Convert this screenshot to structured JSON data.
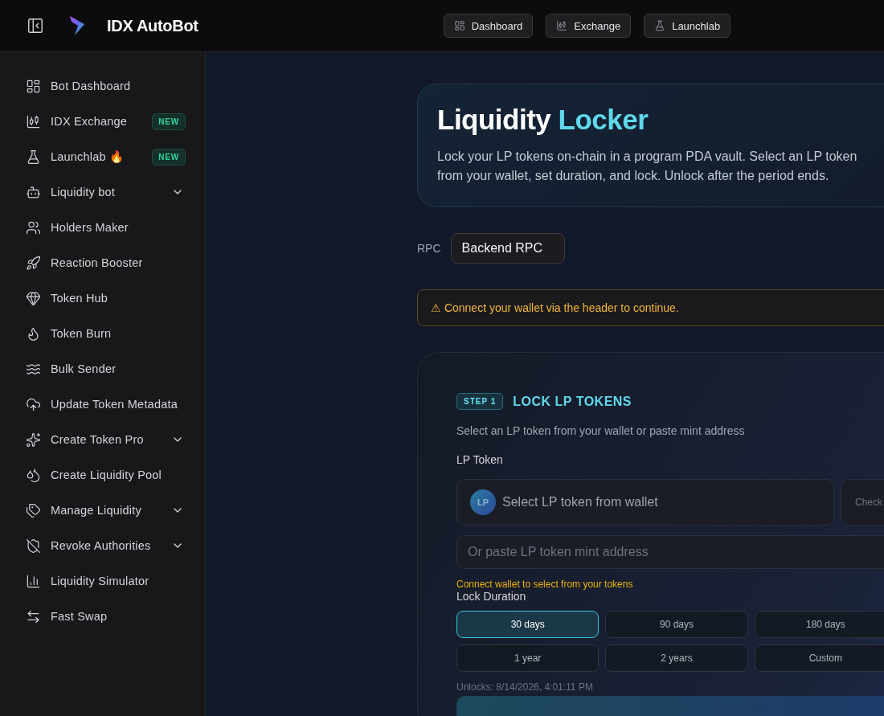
{
  "header": {
    "app_name": "IDX AutoBot",
    "nav": [
      "Dashboard",
      "Exchange",
      "Launchlab"
    ]
  },
  "sidebar": {
    "items": [
      {
        "label": "Bot Dashboard"
      },
      {
        "label": "IDX Exchange",
        "badge": "NEW"
      },
      {
        "label": "Launchlab 🔥",
        "badge": "NEW"
      },
      {
        "label": "Liquidity bot",
        "expanded": false
      },
      {
        "label": "Holders Maker"
      },
      {
        "label": "Reaction Booster"
      },
      {
        "label": "Token Hub"
      },
      {
        "label": "Token Burn"
      },
      {
        "label": "Bulk Sender"
      },
      {
        "label": "Update Token Metadata"
      },
      {
        "label": "Create Token Pro",
        "expanded": false
      },
      {
        "label": "Create Liquidity Pool"
      },
      {
        "label": "Manage Liquidity",
        "expanded": false
      },
      {
        "label": "Revoke Authorities",
        "expanded": false
      },
      {
        "label": "Liquidity Simulator"
      },
      {
        "label": "Fast Swap"
      }
    ]
  },
  "hero": {
    "title": "Liquidity",
    "title_highlight": "Locker",
    "description": "Lock your LP tokens on-chain in a program PDA vault. Select an LP token from your wallet, set duration, and lock. Unlock after the period ends."
  },
  "rpc": {
    "label": "RPC",
    "value": "Backend RPC"
  },
  "warning": "⚠ Connect your wallet via the header to continue.",
  "step": {
    "badge": "STEP 1",
    "title": "LOCK LP TOKENS",
    "subtitle": "Select an LP token from your wallet or paste mint address",
    "lp_label": "LP Token",
    "token_avatar": "LP",
    "select_placeholder": "Select LP token from wallet",
    "check_button": "Check",
    "mint_placeholder": "Or paste LP token mint address",
    "hint": "Connect wallet to select from your tokens",
    "duration_label": "Lock Duration",
    "durations": [
      {
        "label": "30 days",
        "selected": true
      },
      {
        "label": "90 days",
        "selected": false
      },
      {
        "label": "180 days",
        "selected": false
      },
      {
        "label": "1 year",
        "selected": false
      },
      {
        "label": "2 years",
        "selected": false
      },
      {
        "label": "Custom",
        "selected": false
      }
    ],
    "unlocks": "Unlocks: 8/14/2026, 4:01:11 PM"
  }
}
